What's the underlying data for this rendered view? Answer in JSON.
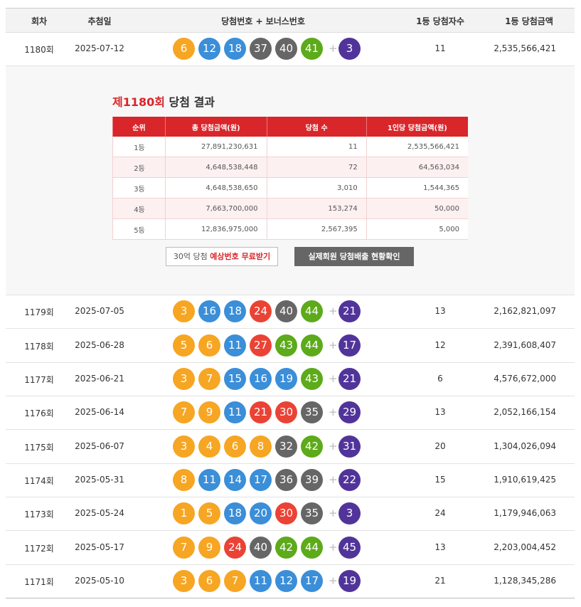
{
  "headers": {
    "round": "회차",
    "date": "추첨일",
    "numbers": "당첨번호 + 보너스번호",
    "winners": "1등 당첨자수",
    "prize": "1등 당첨금액"
  },
  "plus_sign": "+",
  "rows": [
    {
      "round": "1180회",
      "date": "2025-07-12",
      "nums": [
        6,
        12,
        18,
        37,
        40,
        41
      ],
      "bonus": 3,
      "winners": "11",
      "prize": "2,535,566,421"
    },
    {
      "round": "1179회",
      "date": "2025-07-05",
      "nums": [
        3,
        16,
        18,
        24,
        40,
        44
      ],
      "bonus": 21,
      "winners": "13",
      "prize": "2,162,821,097"
    },
    {
      "round": "1178회",
      "date": "2025-06-28",
      "nums": [
        5,
        6,
        11,
        27,
        43,
        44
      ],
      "bonus": 17,
      "winners": "12",
      "prize": "2,391,608,407"
    },
    {
      "round": "1177회",
      "date": "2025-06-21",
      "nums": [
        3,
        7,
        15,
        16,
        19,
        43
      ],
      "bonus": 21,
      "winners": "6",
      "prize": "4,576,672,000"
    },
    {
      "round": "1176회",
      "date": "2025-06-14",
      "nums": [
        7,
        9,
        11,
        21,
        30,
        35
      ],
      "bonus": 29,
      "winners": "13",
      "prize": "2,052,166,154"
    },
    {
      "round": "1175회",
      "date": "2025-06-07",
      "nums": [
        3,
        4,
        6,
        8,
        32,
        42
      ],
      "bonus": 31,
      "winners": "20",
      "prize": "1,304,026,094"
    },
    {
      "round": "1174회",
      "date": "2025-05-31",
      "nums": [
        8,
        11,
        14,
        17,
        36,
        39
      ],
      "bonus": 22,
      "winners": "15",
      "prize": "1,910,619,425"
    },
    {
      "round": "1173회",
      "date": "2025-05-24",
      "nums": [
        1,
        5,
        18,
        20,
        30,
        35
      ],
      "bonus": 3,
      "winners": "24",
      "prize": "1,179,946,063"
    },
    {
      "round": "1172회",
      "date": "2025-05-17",
      "nums": [
        7,
        9,
        24,
        40,
        42,
        44
      ],
      "bonus": 45,
      "winners": "13",
      "prize": "2,203,004,452"
    },
    {
      "round": "1171회",
      "date": "2025-05-10",
      "nums": [
        3,
        6,
        7,
        11,
        12,
        17
      ],
      "bonus": 19,
      "winners": "21",
      "prize": "1,128,345,286"
    }
  ],
  "detail": {
    "title_red": "제1180회",
    "title_rest": " 당첨 결과",
    "table_headers": [
      "순위",
      "총 당첨금액(원)",
      "당첨 수",
      "1인당 당첨금액(원)"
    ],
    "table_rows": [
      [
        "1등",
        "27,891,230,631",
        "11",
        "2,535,566,421"
      ],
      [
        "2등",
        "4,648,538,448",
        "72",
        "64,563,034"
      ],
      [
        "3등",
        "4,648,538,650",
        "3,010",
        "1,544,365"
      ],
      [
        "4등",
        "7,663,700,000",
        "153,274",
        "50,000"
      ],
      [
        "5등",
        "12,836,975,000",
        "2,567,395",
        "5,000"
      ]
    ],
    "btn1_plain": "30억 당첨 ",
    "btn1_highlight": "예상번호 무료받기",
    "btn2": "실제회원 당첨배출 현황확인"
  }
}
